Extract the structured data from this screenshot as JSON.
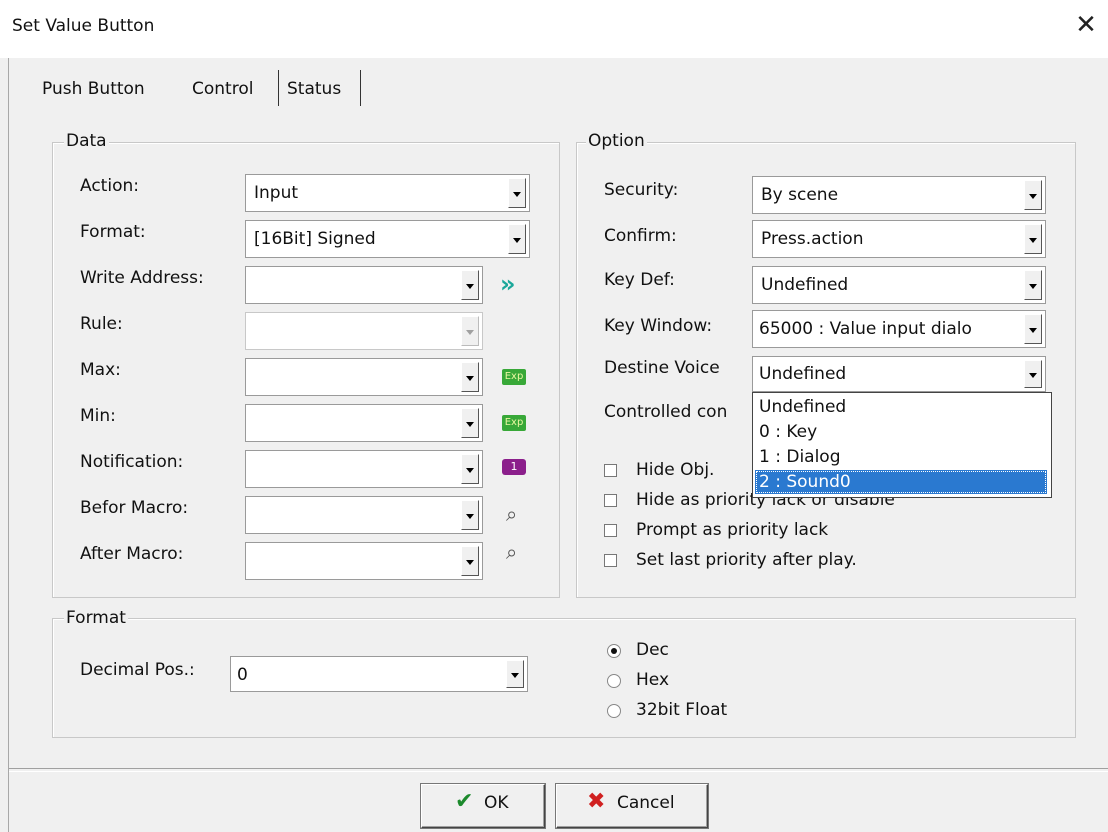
{
  "window": {
    "title": "Set Value Button",
    "close_glyph": "✕"
  },
  "tabs": [
    {
      "label": "Push Button"
    },
    {
      "label": "Control"
    },
    {
      "label": "Status"
    }
  ],
  "data_group": {
    "label": "Data",
    "rows": [
      {
        "label": "Action:",
        "value": "Input"
      },
      {
        "label": "Format:",
        "value": "[16Bit] Signed"
      },
      {
        "label": "Write Address:",
        "value": ""
      },
      {
        "label": "Rule:",
        "value": ""
      },
      {
        "label": "Max:",
        "value": ""
      },
      {
        "label": "Min:",
        "value": ""
      },
      {
        "label": "Notification:",
        "value": ""
      },
      {
        "label": "Befor Macro:",
        "value": ""
      },
      {
        "label": "After Macro:",
        "value": ""
      }
    ],
    "icons": {
      "address": "»",
      "max_exp": "Exp",
      "min_exp": "Exp",
      "notification": "1",
      "macro": "⌕"
    }
  },
  "option_group": {
    "label": "Option",
    "rows": [
      {
        "label": "Security:",
        "value": "By scene"
      },
      {
        "label": "Confirm:",
        "value": "Press.action"
      },
      {
        "label": "Key Def:",
        "value": "Undefined"
      },
      {
        "label": "Key Window:",
        "value": "65000 : Value input dialo"
      },
      {
        "label": "Destine Voice",
        "value": "Undefined"
      }
    ],
    "controlled_label": "Controlled con",
    "checkboxes": [
      {
        "label": "Hide Obj.",
        "checked": false
      },
      {
        "label": "Hide as priority lack or disable",
        "checked": false
      },
      {
        "label": "Prompt as priority lack",
        "checked": false
      },
      {
        "label": "Set last priority after play.",
        "checked": false
      }
    ],
    "dropdown_options": [
      "Undefined",
      "0 : Key",
      "1 : Dialog",
      "2 : Sound0"
    ],
    "dropdown_selected_index": 3
  },
  "format_group": {
    "label": "Format",
    "decimal_label": "Decimal Pos.:",
    "decimal_value": "0",
    "radios": [
      {
        "label": "Dec",
        "checked": true
      },
      {
        "label": "Hex",
        "checked": false
      },
      {
        "label": "32bit Float",
        "checked": false
      }
    ]
  },
  "footer": {
    "ok_label": "OK",
    "cancel_label": "Cancel",
    "ok_icon": "✔",
    "cancel_icon": "✖",
    "colors": {
      "ok_icon": "#1c8a2c",
      "cancel_icon": "#d02020",
      "selection": "#2a79d0"
    }
  }
}
